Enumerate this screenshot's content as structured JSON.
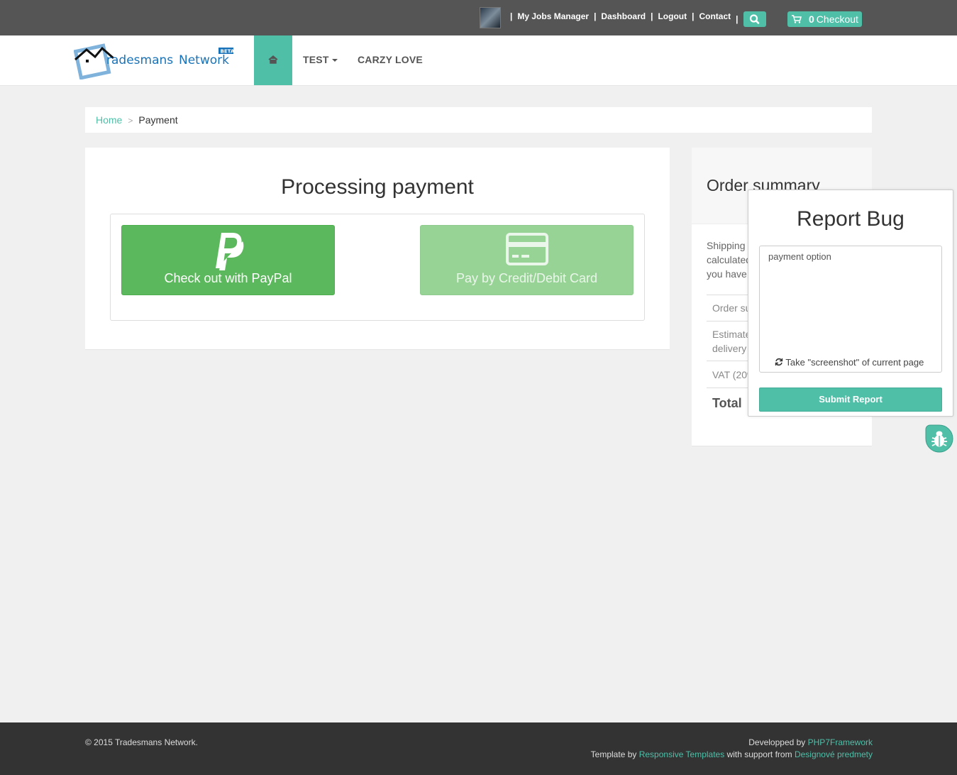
{
  "topbar": {
    "links": [
      "My Jobs Manager",
      "Dashboard",
      "Logout",
      "Contact"
    ],
    "cart_count": "0",
    "checkout_label": "Checkout"
  },
  "brand": {
    "name_part1": "radesmans",
    "name_part2": "Network",
    "badge": "BETA",
    "colors": {
      "accent": "#4fbfa8",
      "brand_blue": "#1a73b8"
    }
  },
  "nav": {
    "items": [
      "TEST",
      "CARZY LOVE"
    ]
  },
  "breadcrumb": {
    "home": "Home",
    "separator": ">",
    "current": "Payment"
  },
  "main": {
    "title": "Processing payment",
    "paypal_label": "Check out with PayPal",
    "card_label": "Pay by Credit/Debit Card"
  },
  "summary": {
    "title": "Order summary",
    "text_lines": [
      "Shipping and",
      "calculated",
      "you have"
    ],
    "rows": [
      "Order subtotal",
      "Estimated",
      "delivery",
      "VAT (20%)"
    ],
    "total_label": "Total"
  },
  "report_bug": {
    "title": "Report Bug",
    "textarea_value": "payment option",
    "screenshot_label": "Take \"screenshot\" of current page",
    "submit_label": "Submit Report"
  },
  "footer": {
    "copyright": "© 2015 Tradesmans Network.",
    "developed_by": "Developped by ",
    "developed_link": "PHP7Framework",
    "template_by": "Template by ",
    "template_link": "Responsive Templates",
    "support_from": " with support from ",
    "support_link": "Designové predmety"
  }
}
